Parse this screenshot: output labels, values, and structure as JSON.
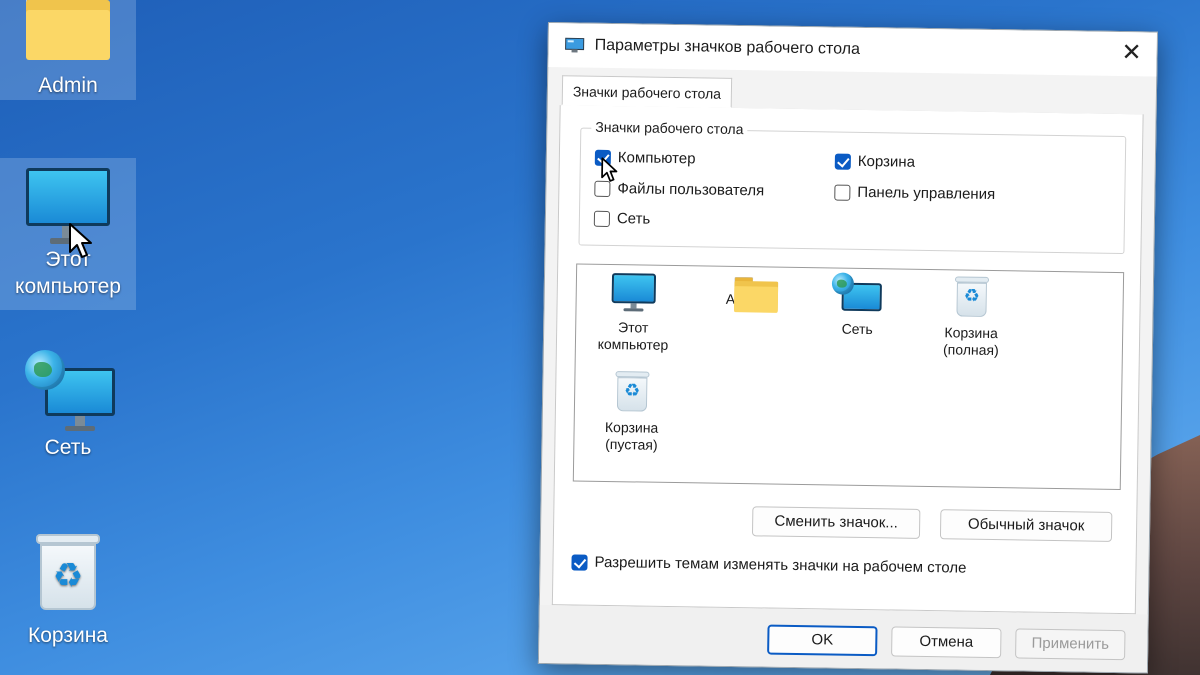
{
  "desktop": {
    "icons": [
      {
        "label": "Admin",
        "icon": "folder-icon"
      },
      {
        "label_line1": "Этот",
        "label_line2": "компьютер",
        "icon": "monitor-icon"
      },
      {
        "label": "Сеть",
        "icon": "network-icon"
      },
      {
        "label": "Корзина",
        "icon": "recycle-bin-icon"
      }
    ]
  },
  "dialog": {
    "title": "Параметры значков рабочего стола",
    "close_glyph": "✕",
    "tab_label": "Значки рабочего стола",
    "group_label": "Значки рабочего стола",
    "checkboxes": [
      {
        "label": "Компьютер",
        "checked": true
      },
      {
        "label": "Корзина",
        "checked": true
      },
      {
        "label": "Файлы пользователя",
        "checked": false
      },
      {
        "label": "Панель управления",
        "checked": false
      },
      {
        "label": "Сеть",
        "checked": false
      }
    ],
    "icon_list": [
      {
        "line1": "Этот",
        "line2": "компьютер",
        "icon": "monitor-icon"
      },
      {
        "line1": "Admin",
        "line2": "",
        "icon": "folder-icon"
      },
      {
        "line1": "Сеть",
        "line2": "",
        "icon": "network-icon"
      },
      {
        "line1": "Корзина",
        "line2": "(полная)",
        "icon": "recycle-bin-full-icon"
      },
      {
        "line1": "Корзина",
        "line2": "(пустая)",
        "icon": "recycle-bin-empty-icon"
      }
    ],
    "change_icon_button": "Сменить значок...",
    "default_icon_button": "Обычный значок",
    "allow_themes": {
      "label": "Разрешить темам изменять значки на рабочем столе",
      "checked": true
    },
    "ok_button": "OK",
    "cancel_button": "Отмена",
    "apply_button": "Применить"
  },
  "colors": {
    "accent": "#0a5bc4",
    "desktop_blue": "#2a74cc"
  }
}
